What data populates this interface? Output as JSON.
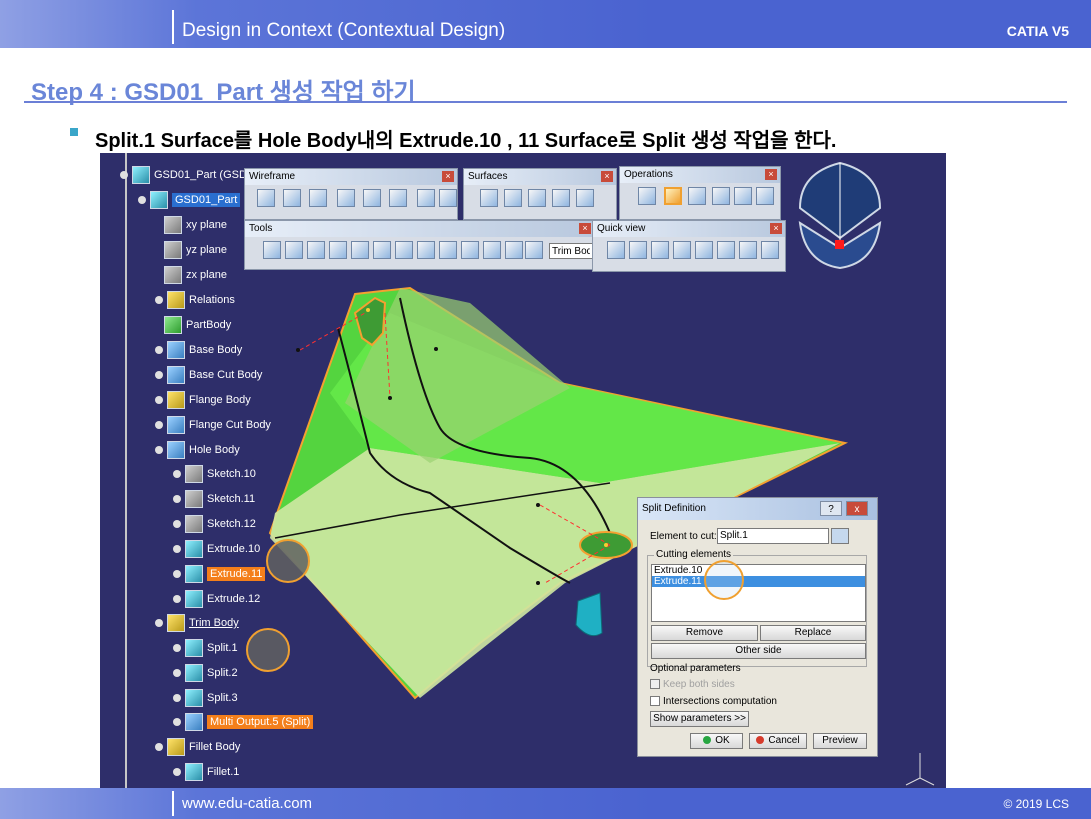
{
  "header": {
    "title": "Design in Context (Contextual Design)",
    "brand": "CATIA V5"
  },
  "step_title": "Step 4 : GSD01_Part 생성 작업 하기",
  "bullet_text": "Split.1 Surface를 Hole Body내의 Extrude.10 , 11 Surface로 Split 생성 작업을 한다.",
  "footer": {
    "url": "www.edu-catia.com",
    "copyright": "© 2019 LCS"
  },
  "tree": {
    "nodes": [
      {
        "label": "GSD01_Part (GSD",
        "state": "normal"
      },
      {
        "label": "GSD01_Part",
        "state": "selected"
      },
      {
        "label": "xy plane",
        "state": "normal"
      },
      {
        "label": "yz plane",
        "state": "normal"
      },
      {
        "label": "zx plane",
        "state": "normal"
      },
      {
        "label": "Relations",
        "state": "normal"
      },
      {
        "label": "PartBody",
        "state": "normal"
      },
      {
        "label": "Base Body",
        "state": "normal"
      },
      {
        "label": "Base Cut Body",
        "state": "normal"
      },
      {
        "label": "Flange Body",
        "state": "normal"
      },
      {
        "label": "Flange Cut Body",
        "state": "normal"
      },
      {
        "label": "Hole Body",
        "state": "normal"
      },
      {
        "label": "Sketch.10",
        "state": "normal"
      },
      {
        "label": "Sketch.11",
        "state": "normal"
      },
      {
        "label": "Sketch.12",
        "state": "normal"
      },
      {
        "label": "Extrude.10",
        "state": "normal"
      },
      {
        "label": "Extrude.11",
        "state": "highlight"
      },
      {
        "label": "Extrude.12",
        "state": "normal"
      },
      {
        "label": "Trim Body",
        "state": "underline"
      },
      {
        "label": "Split.1",
        "state": "normal"
      },
      {
        "label": "Split.2",
        "state": "normal"
      },
      {
        "label": "Split.3",
        "state": "normal"
      },
      {
        "label": "Multi Output.5 (Split)",
        "state": "highlight"
      },
      {
        "label": "Fillet Body",
        "state": "normal"
      },
      {
        "label": "Fillet.1",
        "state": "normal"
      }
    ]
  },
  "toolbars": {
    "wireframe": "Wireframe",
    "surfaces": "Surfaces",
    "operations": "Operations",
    "tools": "Tools",
    "quick_view": "Quick view",
    "trim_body_field": "Trim Bod"
  },
  "split_dialog": {
    "title": "Split Definition",
    "help": "?",
    "close": "x",
    "element_to_cut_label": "Element to cut:",
    "element_to_cut_value": "Split.1",
    "cutting_elements_label": "Cutting elements",
    "cutting_elements": [
      "Extrude.10",
      "Extrude.11"
    ],
    "remove": "Remove",
    "replace": "Replace",
    "other_side": "Other side",
    "optional_parameters": "Optional parameters",
    "keep_both_sides": "Keep both sides",
    "intersections_computation": "Intersections computation",
    "show_parameters": "Show parameters >>",
    "ok": "OK",
    "cancel": "Cancel",
    "preview": "Preview"
  },
  "colors": {
    "header_blue": "#4a63d0",
    "step_blue": "#6a86d8",
    "viewport_bg": "#2e2e6a",
    "surface_green": "#5fe84a",
    "highlight_orange": "#f47f1b"
  }
}
